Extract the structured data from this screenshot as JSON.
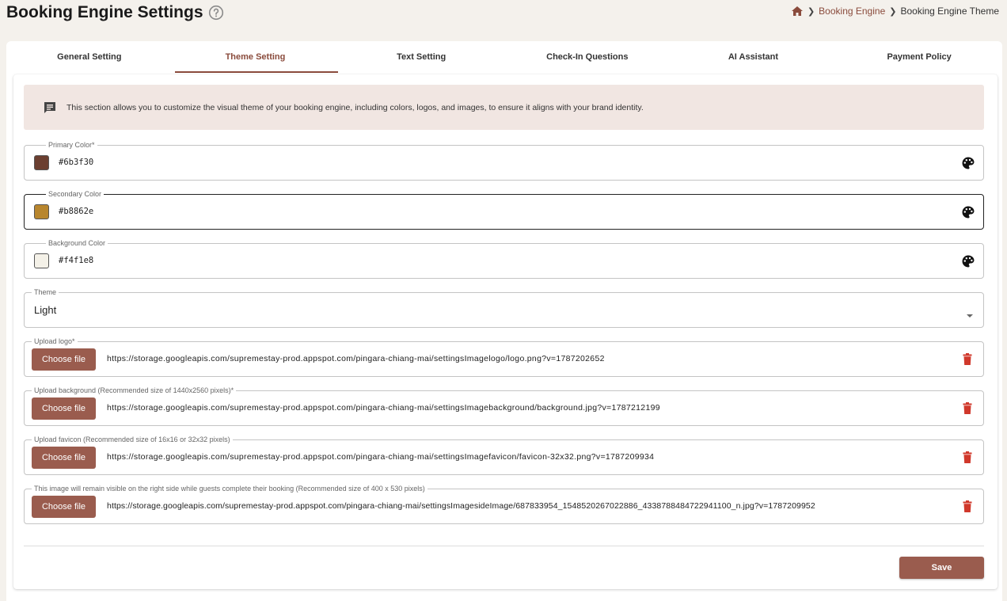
{
  "header": {
    "title": "Booking Engine Settings",
    "help_icon": "question-circle-icon"
  },
  "breadcrumb": {
    "home_icon": "home-icon",
    "items": [
      "Booking Engine",
      "Booking Engine Theme"
    ]
  },
  "tabs": [
    {
      "label": "General Setting",
      "active": false
    },
    {
      "label": "Theme Setting",
      "active": true
    },
    {
      "label": "Text Setting",
      "active": false
    },
    {
      "label": "Check-In Questions",
      "active": false
    },
    {
      "label": "AI Assistant",
      "active": false
    },
    {
      "label": "Payment Policy",
      "active": false
    }
  ],
  "info": {
    "icon": "message-icon",
    "text": "This section allows you to customize the visual theme of your booking engine, including colors, logos, and images, to ensure it aligns with your brand identity."
  },
  "colors": {
    "primary": {
      "label": "Primary Color*",
      "value": "#6b3f30"
    },
    "secondary": {
      "label": "Secondary Color",
      "value": "#b8862e"
    },
    "background": {
      "label": "Background Color",
      "value": "#f4f1e8"
    }
  },
  "theme": {
    "label": "Theme",
    "value": "Light"
  },
  "uploads": {
    "button_label": "Choose file",
    "logo": {
      "label": "Upload logo*",
      "url": "https://storage.googleapis.com/supremestay-prod.appspot.com/pingara-chiang-mai/settingsImagelogo/logo.png?v=1787202652"
    },
    "background": {
      "label": "Upload background (Recommended size of 1440x2560 pixels)*",
      "url": "https://storage.googleapis.com/supremestay-prod.appspot.com/pingara-chiang-mai/settingsImagebackground/background.jpg?v=1787212199"
    },
    "favicon": {
      "label": "Upload favicon (Recommended size of 16x16 or 32x32 pixels)",
      "url": "https://storage.googleapis.com/supremestay-prod.appspot.com/pingara-chiang-mai/settingsImagefavicon/favicon-32x32.png?v=1787209934"
    },
    "side_image": {
      "label": "This image will remain visible on the right side while guests complete their booking (Recommended size of 400 x 530 pixels)",
      "url": "https://storage.googleapis.com/supremestay-prod.appspot.com/pingara-chiang-mai/settingsImagesideImage/687833954_1548520267022886_4338788484722941100_n.jpg?v=1787209952"
    }
  },
  "actions": {
    "save_label": "Save"
  },
  "accent_colors": {
    "brand": "#8a4b3c",
    "button": "#9a5c4e",
    "danger": "#d0382b"
  }
}
